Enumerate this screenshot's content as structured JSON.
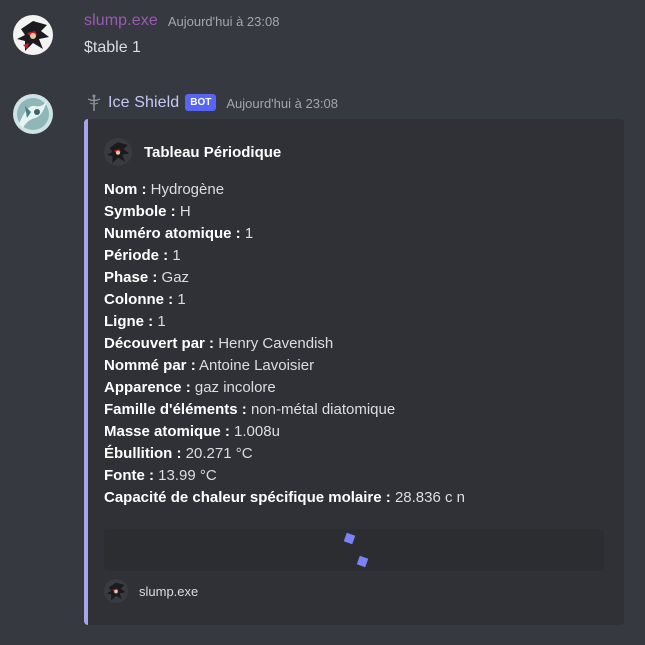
{
  "colors": {
    "background": "#36393f",
    "embed_background": "#2f3136",
    "embed_accent": "#a5a6ea",
    "user_name_color": "#9b59b6",
    "bot_name_color": "#c7c9f5",
    "bot_badge": "#5865f2"
  },
  "messages": [
    {
      "author": "slump.exe",
      "avatar": "shadow-hedgehog-avatar",
      "timestamp": "Aujourd'hui à 23:08",
      "content": "$table 1"
    },
    {
      "author": "Ice Shield",
      "author_icon": "staff-icon",
      "badge": "BOT",
      "avatar": "ice-dragon-avatar",
      "timestamp": "Aujourd'hui à 23:08",
      "embed": {
        "author_name": "Tableau Périodique",
        "author_icon": "shadow-hedgehog-avatar",
        "fields": [
          {
            "name": "Nom :",
            "value": "Hydrogène"
          },
          {
            "name": "Symbole :",
            "value": "H"
          },
          {
            "name": "Numéro atomique :",
            "value": "1"
          },
          {
            "name": "Période :",
            "value": "1"
          },
          {
            "name": "Phase :",
            "value": "Gaz"
          },
          {
            "name": "Colonne :",
            "value": "1"
          },
          {
            "name": "Ligne :",
            "value": "1"
          },
          {
            "name": "Découvert par :",
            "value": "Henry Cavendish"
          },
          {
            "name": "Nommé par :",
            "value": "Antoine Lavoisier"
          },
          {
            "name": "Apparence :",
            "value": "gaz incolore"
          },
          {
            "name": "Famille d'éléments :",
            "value": "non-métal diatomique"
          },
          {
            "name": "Masse atomique :",
            "value": "1.008u"
          },
          {
            "name": "Ébullition :",
            "value": "20.271 °C"
          },
          {
            "name": "Fonte :",
            "value": "13.99 °C"
          },
          {
            "name": "Capacité de chaleur spécifique molaire :",
            "value": "28.836 c n"
          }
        ],
        "image_state": "loading",
        "footer_text": "slump.exe",
        "footer_icon": "shadow-hedgehog-avatar"
      }
    }
  ]
}
